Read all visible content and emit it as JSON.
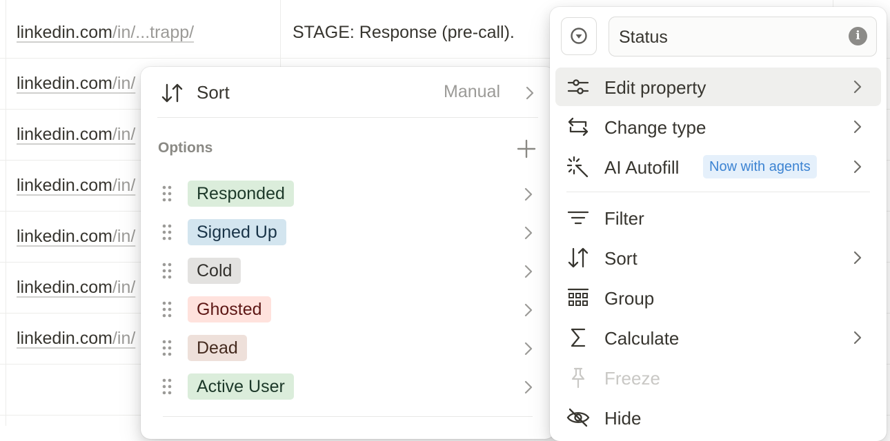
{
  "table": {
    "rows": [
      {
        "domain": "linkedin.com",
        "path": "/in/...trapp/",
        "note": "STAGE: Response (pre-call)."
      },
      {
        "domain": "linkedin.com",
        "path": "/in/",
        "note": ""
      },
      {
        "domain": "linkedin.com",
        "path": "/in/",
        "note": ""
      },
      {
        "domain": "linkedin.com",
        "path": "/in/",
        "note": ""
      },
      {
        "domain": "linkedin.com",
        "path": "/in/",
        "note": ""
      },
      {
        "domain": "linkedin.com",
        "path": "/in/",
        "note": ""
      },
      {
        "domain": "linkedin.com",
        "path": "/in/",
        "note": ""
      }
    ]
  },
  "options_menu": {
    "sort_label": "Sort",
    "sort_value": "Manual",
    "options_heading": "Options",
    "options": [
      {
        "label": "Responded",
        "bg": "#dbeddb",
        "fg": "#1c3829"
      },
      {
        "label": "Signed Up",
        "bg": "#d3e5ef",
        "fg": "#183347"
      },
      {
        "label": "Cold",
        "bg": "#e3e2e0",
        "fg": "#32302c"
      },
      {
        "label": "Ghosted",
        "bg": "#ffe2dd",
        "fg": "#5d1715"
      },
      {
        "label": "Dead",
        "bg": "#eee0da",
        "fg": "#442a1e"
      },
      {
        "label": "Active User",
        "bg": "#dbeddb",
        "fg": "#1c3829"
      }
    ]
  },
  "property_menu": {
    "name_value": "Status",
    "info_glyph": "i",
    "items": [
      {
        "label": "Edit property",
        "icon": "sliders-icon",
        "chevron": true,
        "highlight": true
      },
      {
        "label": "Change type",
        "icon": "change-type-icon",
        "chevron": true
      },
      {
        "label": "AI Autofill",
        "icon": "sparkle-icon",
        "chevron": true,
        "badge": "Now with agents"
      },
      {
        "label": "Filter",
        "icon": "filter-icon",
        "chevron": false
      },
      {
        "label": "Sort",
        "icon": "sort-icon",
        "chevron": true
      },
      {
        "label": "Group",
        "icon": "group-icon",
        "chevron": false
      },
      {
        "label": "Calculate",
        "icon": "sigma-icon",
        "chevron": true
      },
      {
        "label": "Freeze",
        "icon": "pin-icon",
        "chevron": false,
        "disabled": true
      },
      {
        "label": "Hide",
        "icon": "eye-slash-icon",
        "chevron": false
      }
    ]
  },
  "colors": {
    "badge_bg": "#e5f0fb",
    "badge_fg": "#3c83d2",
    "highlight_bg": "#efefed"
  }
}
